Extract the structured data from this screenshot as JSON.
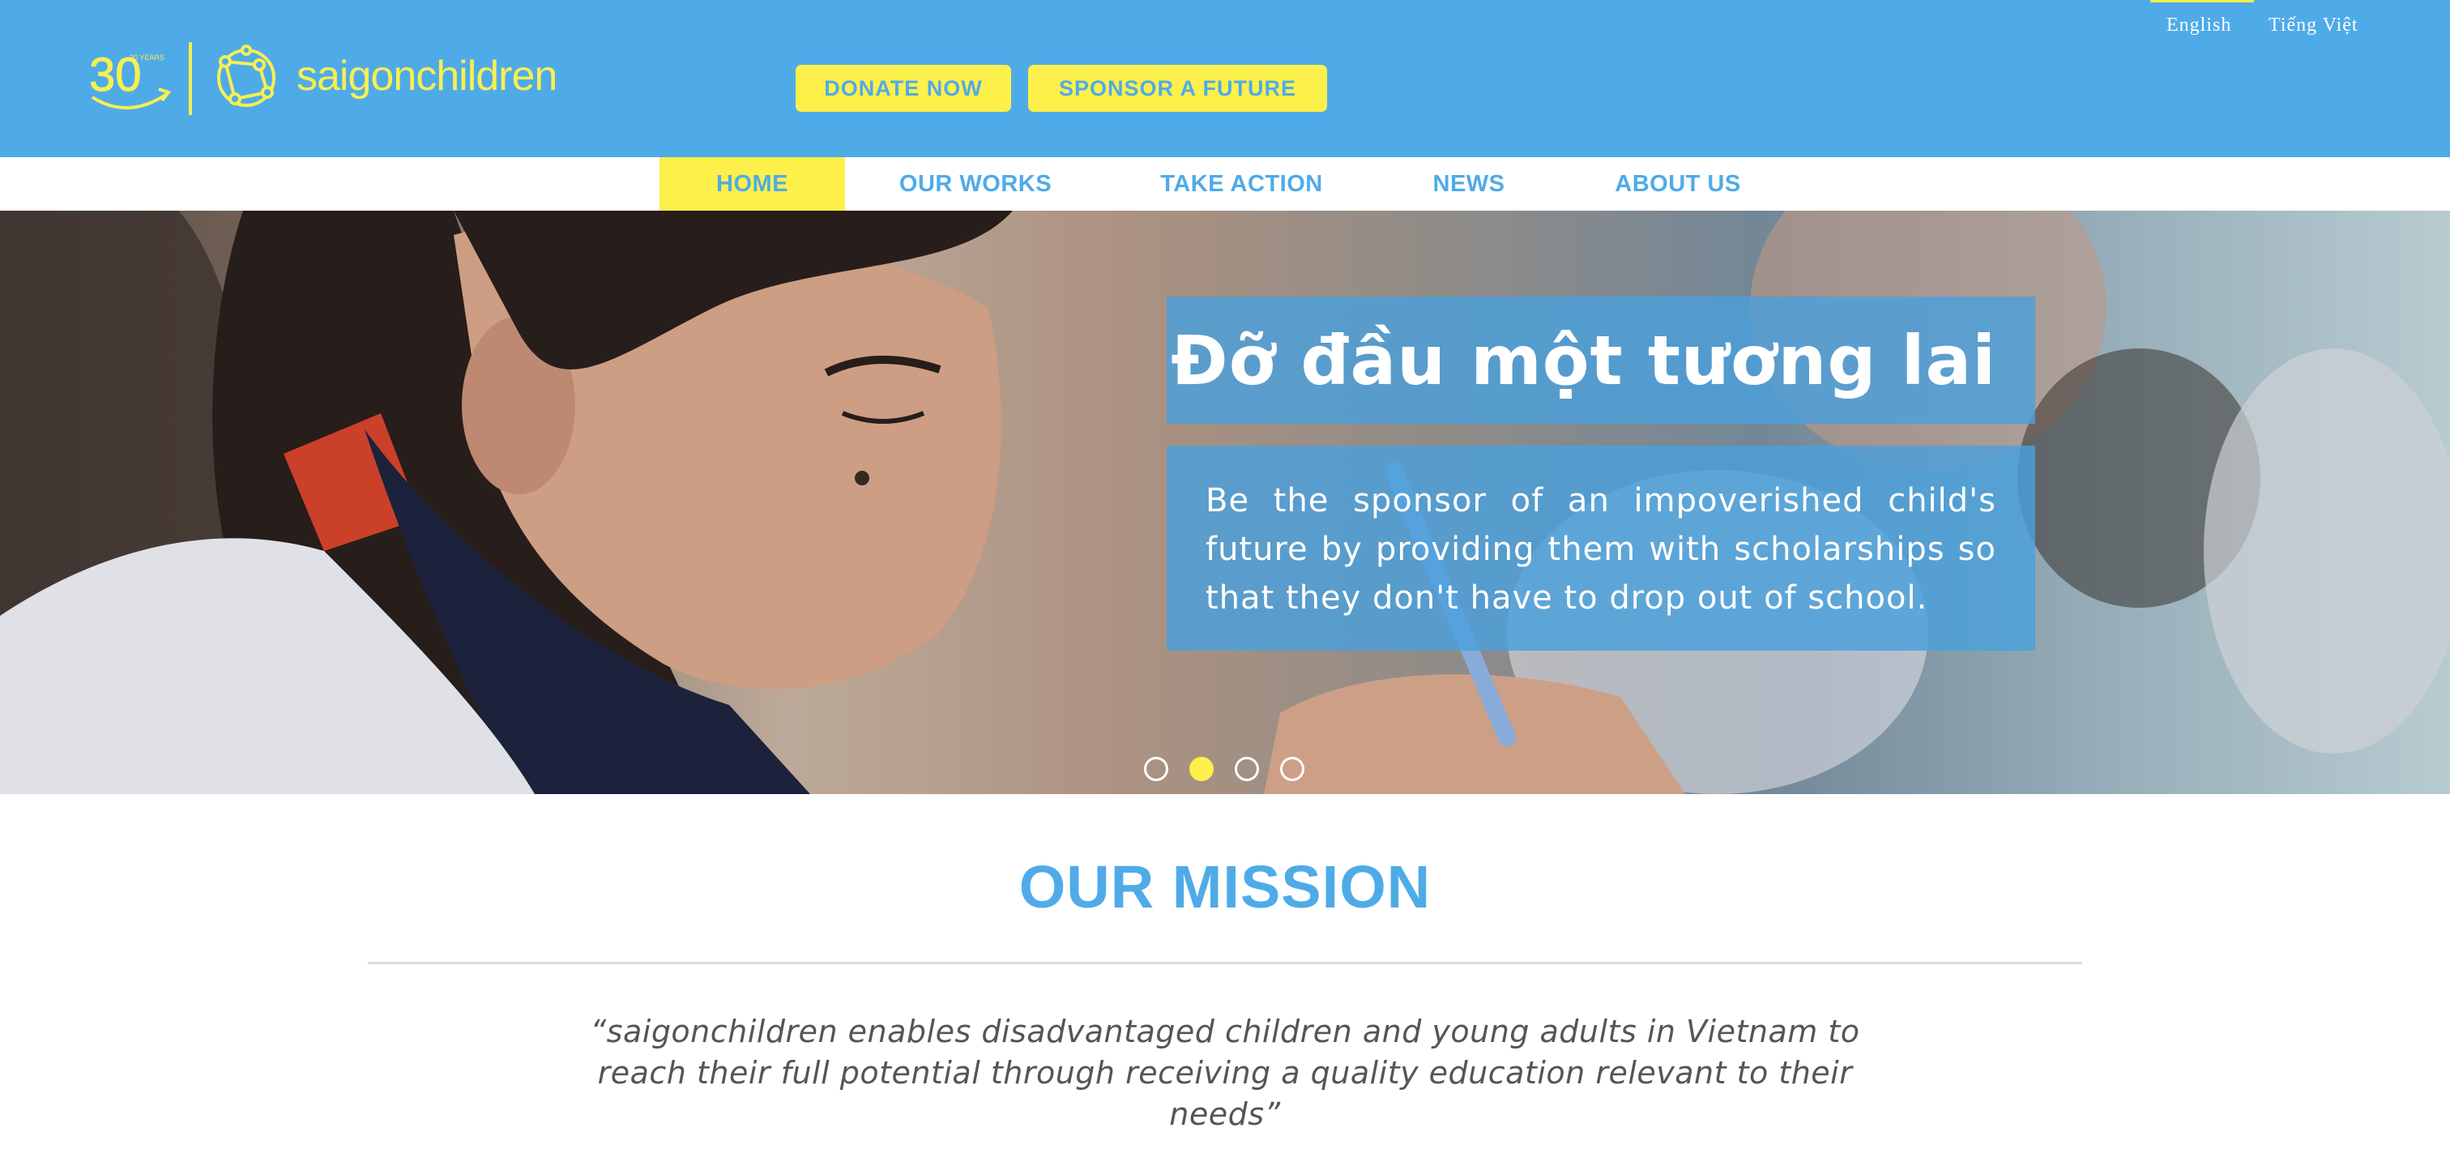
{
  "header": {
    "logo_text": "saigonchildren",
    "logo_badge": "30 YEARS",
    "donate_label": "DONATE NOW",
    "sponsor_label": "SPONSOR A FUTURE",
    "languages": [
      "English",
      "Tiếng Việt"
    ],
    "active_language": "English"
  },
  "nav": {
    "items": [
      "HOME",
      "OUR WORKS",
      "TAKE ACTION",
      "NEWS",
      "ABOUT US"
    ],
    "active": "HOME"
  },
  "hero": {
    "title": "Đỡ đầu một tương lai",
    "text": "Be the sponsor of an impoverished child's future by providing them with scholarships so that they don't have to drop out of school.",
    "slide_count": 4,
    "active_slide": 2
  },
  "mission": {
    "title": "OUR MISSION",
    "quote": "“saigonchildren enables disadvantaged children and young adults in Vietnam to reach their full potential through receiving a quality education relevant to their needs”"
  },
  "colors": {
    "brand_blue": "#4fabe8",
    "brand_yellow": "#fdf04a"
  }
}
